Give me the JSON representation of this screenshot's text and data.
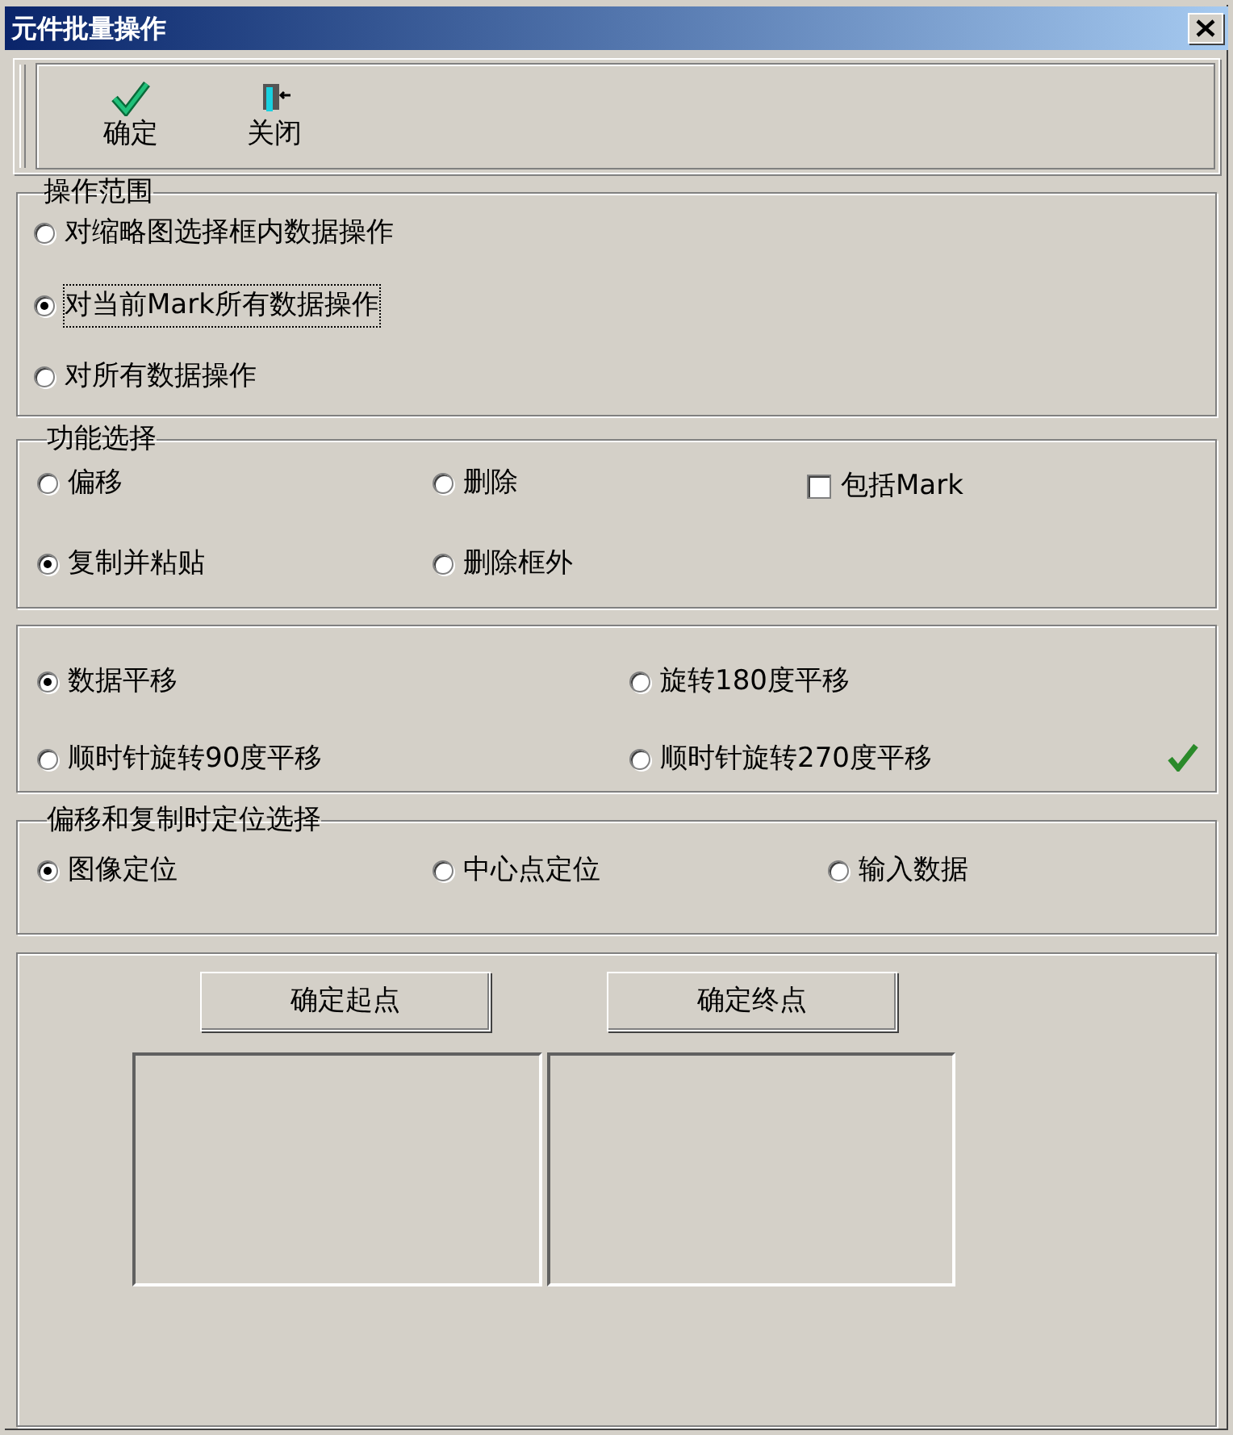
{
  "window": {
    "title": "元件批量操作"
  },
  "toolbar": {
    "buttons": [
      {
        "kind": "ok",
        "label": "确定"
      },
      {
        "kind": "exit",
        "label": "关闭"
      }
    ]
  },
  "scope": {
    "title": "操作范围",
    "options": [
      {
        "label": "对缩略图选择框内数据操作",
        "selected": false,
        "focused": false
      },
      {
        "label": "对当前Mark所有数据操作",
        "selected": true,
        "focused": true
      },
      {
        "label": "对所有数据操作",
        "selected": false,
        "focused": false
      }
    ]
  },
  "function": {
    "title": "功能选择",
    "items": [
      {
        "kind": "radio",
        "label": "偏移",
        "selected": false
      },
      {
        "kind": "radio",
        "label": "删除",
        "selected": false
      },
      {
        "kind": "checkbox",
        "label": "包括Mark",
        "checked": false
      },
      {
        "kind": "radio",
        "label": "复制并粘贴",
        "selected": true
      },
      {
        "kind": "radio",
        "label": "删除框外",
        "selected": false
      }
    ]
  },
  "transform": {
    "options": [
      {
        "label": "数据平移",
        "selected": true
      },
      {
        "label": "旋转180度平移",
        "selected": false
      },
      {
        "label": "顺时针旋转90度平移",
        "selected": false
      },
      {
        "label": "顺时针旋转270度平移",
        "selected": false
      }
    ]
  },
  "positioning": {
    "title": "偏移和复制时定位选择",
    "options": [
      {
        "label": "图像定位",
        "selected": true
      },
      {
        "label": "中心点定位",
        "selected": false
      },
      {
        "label": "输入数据",
        "selected": false
      }
    ]
  },
  "points": {
    "buttons": [
      "确定起点",
      "确定终点"
    ]
  }
}
